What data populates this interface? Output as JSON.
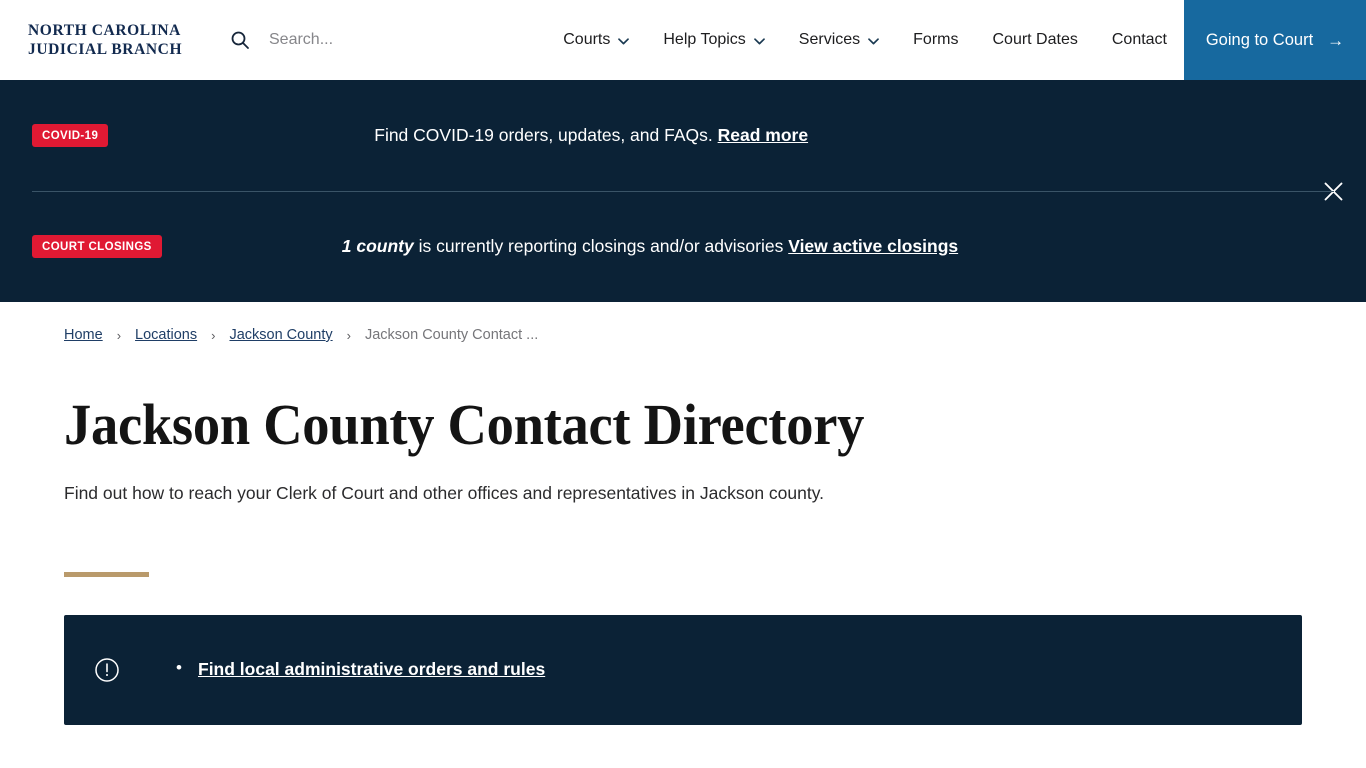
{
  "header": {
    "logo_line1": "NORTH CAROLINA",
    "logo_line2": "JUDICIAL BRANCH",
    "search_placeholder": "Search...",
    "search_value": "",
    "search_icon": "search-icon",
    "nav": [
      {
        "label": "Courts",
        "has_dropdown": true
      },
      {
        "label": "Help Topics",
        "has_dropdown": true
      },
      {
        "label": "Services",
        "has_dropdown": true
      },
      {
        "label": "Forms",
        "has_dropdown": false
      },
      {
        "label": "Court Dates",
        "has_dropdown": false
      },
      {
        "label": "Contact",
        "has_dropdown": false
      }
    ],
    "cta_label": "Going to Court",
    "cta_arrow": "→",
    "cta_color": "#17699f"
  },
  "alerts": {
    "close_icon": "close-icon",
    "badge_color": "#e01933",
    "background": "#0b2236",
    "items": [
      {
        "badge": "COVID-19",
        "text": "Find COVID-19 orders, updates, and FAQs.",
        "link": "Read more"
      },
      {
        "badge": "COURT CLOSINGS",
        "count": "1 county",
        "text": "is currently reporting closings and/or advisories",
        "link": "View active closings"
      }
    ]
  },
  "breadcrumb": {
    "separator": "›",
    "items": [
      {
        "label": "Home",
        "current": false
      },
      {
        "label": "Locations",
        "current": false
      },
      {
        "label": "Jackson County",
        "current": false
      },
      {
        "label": "Jackson County Contact ...",
        "current": true
      }
    ]
  },
  "page": {
    "title": "Jackson County Contact Directory",
    "description": "Find out how to reach your Clerk of Court and other offices and representatives in Jackson county.",
    "accent_color": "#b99a6b"
  },
  "callout": {
    "icon": "alert-circle-icon",
    "background": "#0b2236",
    "links": [
      "Find local administrative orders and rules"
    ]
  }
}
